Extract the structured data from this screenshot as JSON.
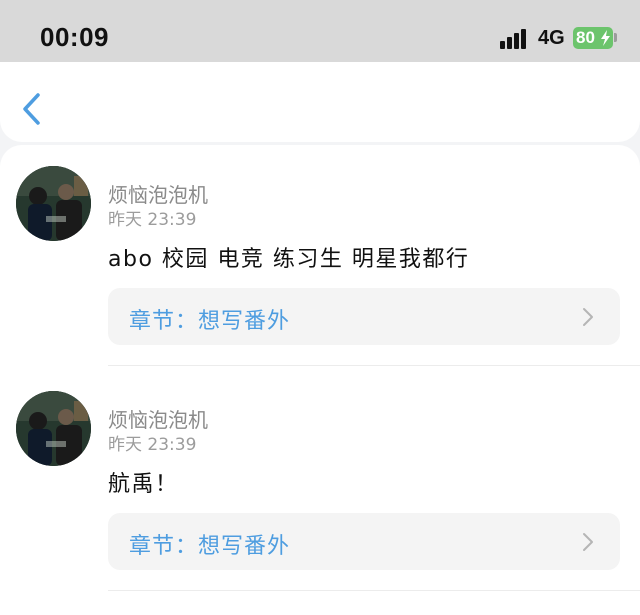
{
  "status_bar": {
    "time": "00:09",
    "network": "4G",
    "battery": "80"
  },
  "nav": {
    "back_icon": "chevron-left-icon"
  },
  "comments": [
    {
      "author": "烦恼泡泡机",
      "time": "昨天 23:39",
      "text": "abo 校园 电竞 练习生 明星我都行",
      "chapter": "章节：想写番外"
    },
    {
      "author": "烦恼泡泡机",
      "time": "昨天 23:39",
      "text": "航禹！",
      "chapter": "章节：想写番外"
    }
  ],
  "colors": {
    "accent": "#4e9de0",
    "status_bar_bg": "#d9d9d9",
    "battery": "#6cc46c"
  }
}
